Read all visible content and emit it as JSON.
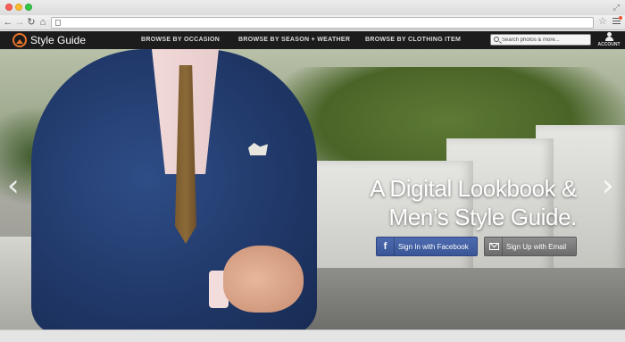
{
  "browser": {
    "address_value": "",
    "icons": [
      "back-arrow",
      "forward-arrow",
      "reload",
      "home",
      "star",
      "menu"
    ]
  },
  "site": {
    "logo_text": "Style Guide",
    "nav": {
      "occasion": "BROWSE BY OCCASION",
      "season": "BROWSE BY SEASON + WEATHER",
      "clothing": "BROWSE BY CLOTHING ITEM"
    },
    "search": {
      "placeholder": "Search photos & more..."
    },
    "account_label": "ACCOUNT",
    "accent_color": "#e8742a"
  },
  "hero": {
    "headline_line1": "A Digital Lookbook &",
    "headline_line2": "Men’s Style Guide.",
    "facebook_button": {
      "icon": "f",
      "label": "Sign In with Facebook",
      "color": "#3f5a9c"
    },
    "email_button": {
      "label": "Sign Up with Email",
      "color": "#7a7a7a"
    }
  }
}
